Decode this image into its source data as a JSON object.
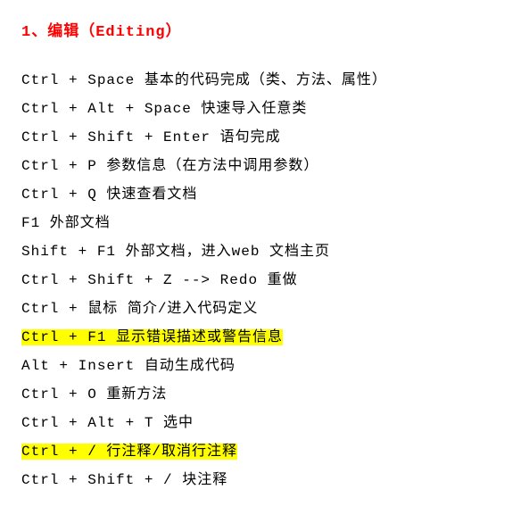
{
  "heading": "1、编辑（Editing）",
  "shortcuts": [
    {
      "text": "Ctrl + Space 基本的代码完成（类、方法、属性）",
      "highlighted": false
    },
    {
      "text": "Ctrl + Alt + Space 快速导入任意类",
      "highlighted": false
    },
    {
      "text": "Ctrl + Shift + Enter    语句完成",
      "highlighted": false
    },
    {
      "text": "Ctrl + P 参数信息（在方法中调用参数）",
      "highlighted": false
    },
    {
      "text": "Ctrl + Q 快速查看文档",
      "highlighted": false
    },
    {
      "text": "F1   外部文档",
      "highlighted": false
    },
    {
      "text": "Shift + F1 外部文档，进入web 文档主页",
      "highlighted": false
    },
    {
      "text": "Ctrl + Shift + Z --> Redo 重做",
      "highlighted": false
    },
    {
      "text": "Ctrl + 鼠标 简介/进入代码定义",
      "highlighted": false
    },
    {
      "text": "Ctrl + F1 显示错误描述或警告信息",
      "highlighted": true
    },
    {
      "text": "Alt + Insert 自动生成代码",
      "highlighted": false
    },
    {
      "text": "Ctrl + O 重新方法",
      "highlighted": false
    },
    {
      "text": "Ctrl + Alt + T  选中",
      "highlighted": false
    },
    {
      "text": "Ctrl + / 行注释/取消行注释",
      "highlighted": true
    },
    {
      "text": "Ctrl + Shift + /   块注释",
      "highlighted": false
    }
  ]
}
